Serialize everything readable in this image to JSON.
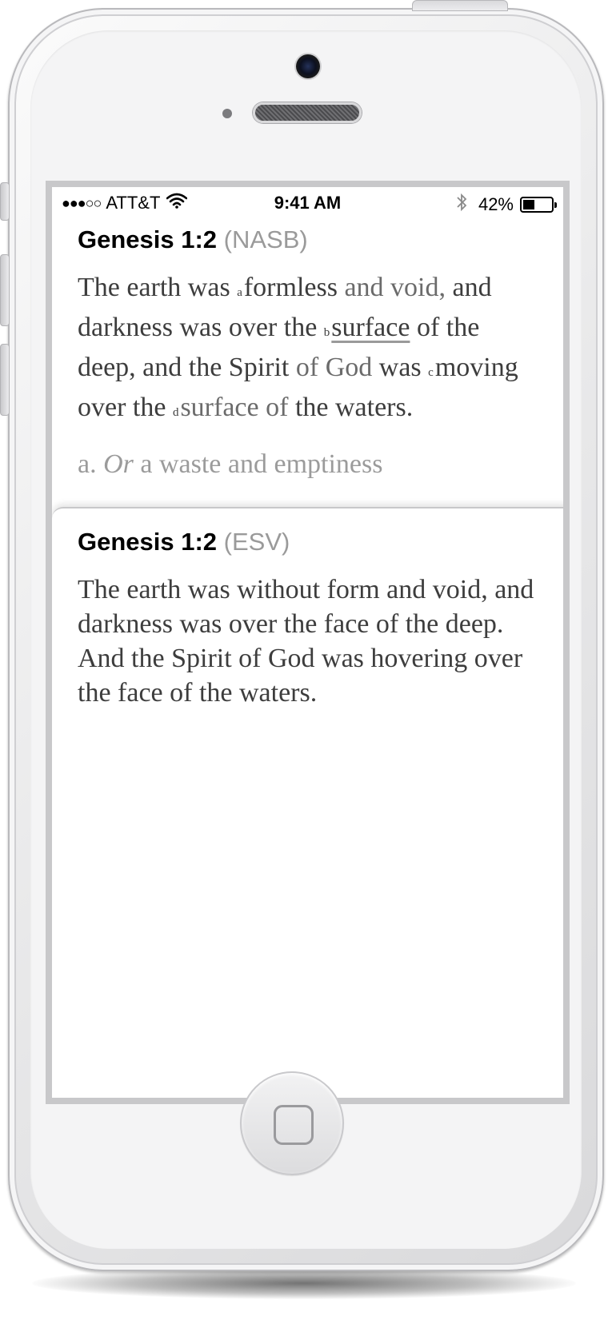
{
  "status_bar": {
    "signal": "●●●○○",
    "carrier": "ATT&T",
    "time": "9:41 AM",
    "battery_percent": "42%",
    "battery_level": 0.42,
    "icons": [
      "wifi-icon",
      "bluetooth-icon",
      "battery-icon"
    ]
  },
  "nasb": {
    "reference": "Genesis 1:2",
    "version": "(NASB)",
    "text_1": "The earth was ",
    "fn_a": "a",
    "text_2": "formless",
    "text_3": " and void,",
    "text_4": " and darkness was over the ",
    "fn_b": "b",
    "text_5": "surface",
    "text_6": " of the deep, and the Spirit ",
    "text_7": "of God",
    "text_8": " was ",
    "fn_c": "c",
    "text_9": "moving over the ",
    "fn_d": "d",
    "text_10": "surface of",
    "text_11": " the waters.",
    "footnote_label": "a. ",
    "footnote_or": "Or",
    "footnote_text": " a waste and emptiness"
  },
  "esv": {
    "reference": "Genesis 1:2",
    "version": "(ESV)",
    "text": "The earth was without form and void, and darkness was over the face of the deep. And the Spirit of God was hovering over the face of the waters."
  },
  "colors": {
    "title": "#000000",
    "version": "#9a9a9a",
    "verse": "#3d3d3d",
    "footnote": "#9b9b9b"
  }
}
